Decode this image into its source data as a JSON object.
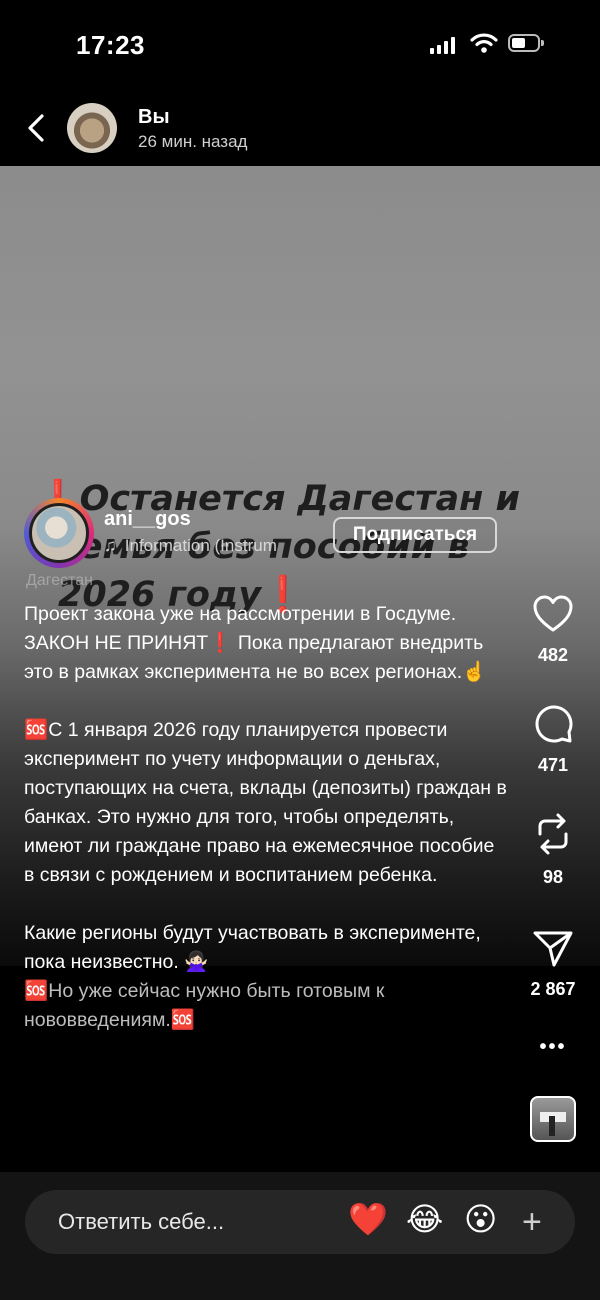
{
  "status_bar": {
    "time": "17:23"
  },
  "header": {
    "name": "Вы",
    "subtitle": "26 мин. назад"
  },
  "story": {
    "headline_line1": "Останется Дагестан и",
    "headline_line2": "семья без пособий в",
    "headline_line3": "2026 году",
    "headline_mark": "❗",
    "username": "ani__gos",
    "audio": "Information (Instrum",
    "follow_label": "Подписаться",
    "tag": "Дагестан",
    "caption": {
      "p1": "Проект закона уже на рассмотрении в Госдуме. ЗАКОН НЕ ПРИНЯТ❗ Пока предлагают внедрить это в рамках эксперимента не во всех регионах.☝️",
      "p2": "🆘С 1 января 2026 году планируется провести эксперимент по учету информации о деньгах, поступающих на счета, вклады (депозиты) граждан в банках. Это нужно для того, чтобы определять, имеют ли граждане право на ежемесячное пособие в связи с рождением и воспитанием ребенка.",
      "p3a": "Какие регионы будут участвовать в эксперименте, пока неизвестно. 🙅🏻‍♀️",
      "p3b": "🆘Но уже сейчас нужно быть готовым к нововведениям.🆘"
    }
  },
  "actions": {
    "likes": "482",
    "comments": "471",
    "reposts": "98",
    "shares": "2 867",
    "more": "•••"
  },
  "reply": {
    "placeholder": "Ответить себе...",
    "emoji1": "❤️",
    "emoji2": "😂",
    "emoji3": "😮",
    "plus": "+"
  },
  "icons": [
    "back-chevron-icon",
    "heart-icon",
    "comment-icon",
    "repost-icon",
    "send-icon",
    "more-icon",
    "music-note-icon"
  ]
}
